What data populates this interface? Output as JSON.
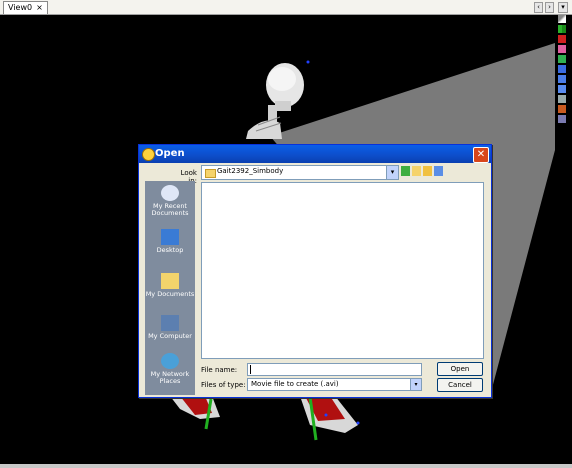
{
  "view_tab": {
    "label": "View0",
    "close": "×"
  },
  "nav": {
    "prev": "‹",
    "next": "›",
    "menu": "▾"
  },
  "dialog": {
    "title": "Open",
    "close": "✕",
    "look_in_label": "Look in:",
    "look_in_value": "Gait2392_Simbody",
    "places": [
      {
        "label": "My Recent Documents"
      },
      {
        "label": "Desktop"
      },
      {
        "label": "My Documents"
      },
      {
        "label": "My Computer"
      },
      {
        "label": "My Network Places"
      }
    ],
    "file_name_label": "File name:",
    "file_name_value": "",
    "files_of_type_label": "Files of type:",
    "files_of_type_value": "Movie file to create (.avi)",
    "open_label": "Open",
    "cancel_label": "Cancel"
  },
  "colors": {
    "title_bar": "#0a5fe8",
    "viewport_bg": "#000000",
    "close_button": "#d8461b"
  }
}
